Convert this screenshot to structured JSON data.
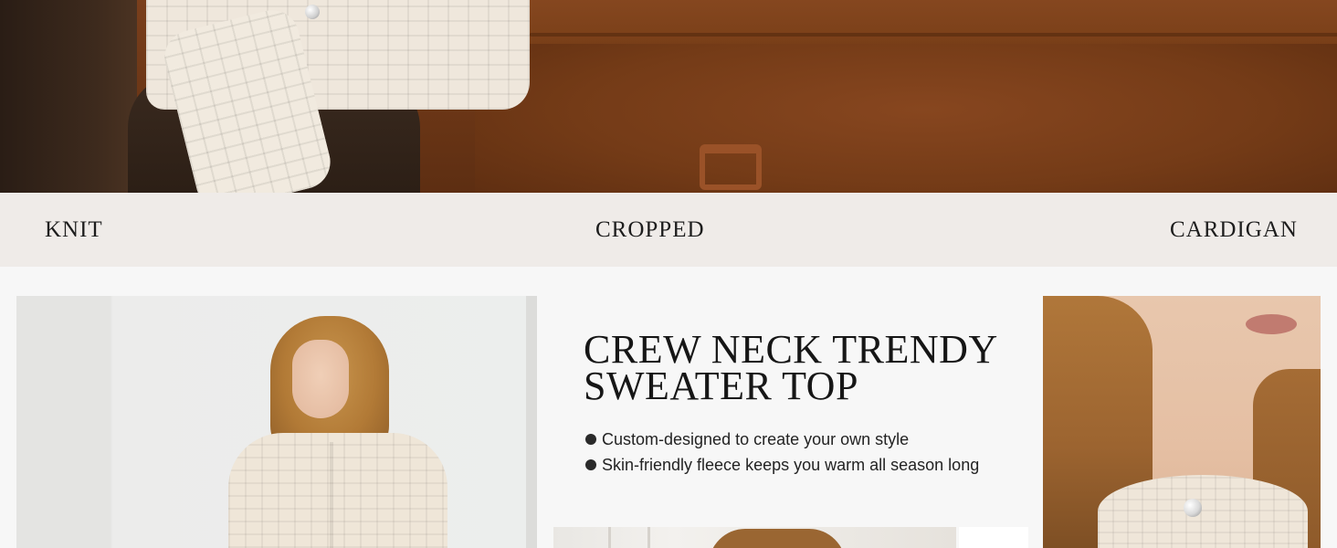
{
  "keywords": {
    "knit": "KNIT",
    "cropped": "CROPPED",
    "cardigan": "CARDIGAN"
  },
  "product": {
    "title": "CREW NECK TRENDY SWEATER TOP",
    "features": [
      "Custom-designed to create your own style",
      "Skin-friendly fleece keeps you warm all season long"
    ]
  },
  "colors": {
    "strip_background": "#efebe8",
    "page_background": "#f7f7f7",
    "text": "#1d1d1d",
    "sofa_brown": "#7a3f1c",
    "sweater_cream": "#efe7dc"
  },
  "images": {
    "hero": "model in cream knit cardigan on brown velvet sofa",
    "left": "model wearing cream knit cardigan",
    "middle": "model photo (partial)",
    "right": "close-up of neckline with pearl button"
  }
}
